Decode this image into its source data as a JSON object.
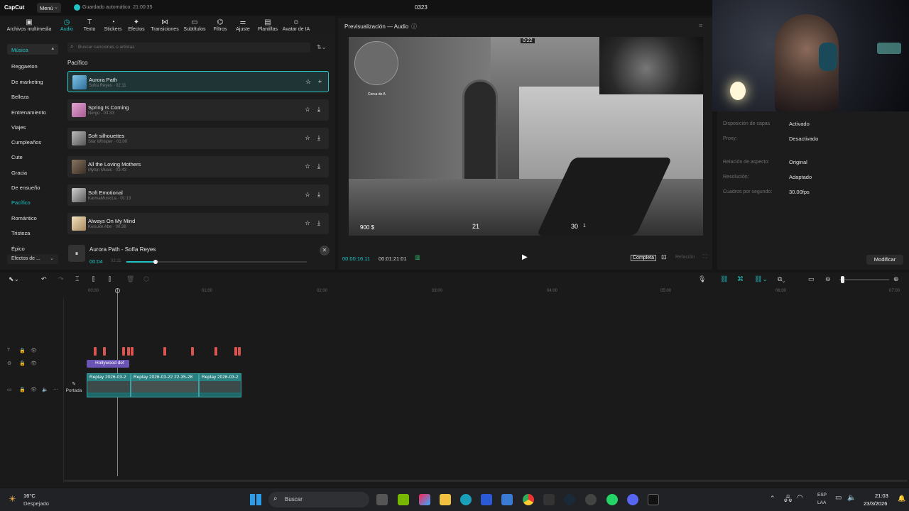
{
  "titlebar": {
    "app_name": "CapCut",
    "menu_label": "Menú",
    "autosave": "Guardado automático: 21:00:35",
    "project_name": "0323"
  },
  "toolbar": {
    "items": [
      {
        "label": "Archivos multimedia",
        "icon": "media-icon"
      },
      {
        "label": "Audio",
        "icon": "audio-icon"
      },
      {
        "label": "Texto",
        "icon": "text-icon"
      },
      {
        "label": "Stickers",
        "icon": "sticker-icon"
      },
      {
        "label": "Efectos",
        "icon": "effects-icon"
      },
      {
        "label": "Transiciones",
        "icon": "transitions-icon"
      },
      {
        "label": "Subtítulos",
        "icon": "subtitles-icon"
      },
      {
        "label": "Filtros",
        "icon": "filters-icon"
      },
      {
        "label": "Ajuste",
        "icon": "adjust-icon"
      },
      {
        "label": "Plantillas",
        "icon": "templates-icon"
      },
      {
        "label": "Avatar de IA",
        "icon": "ai-avatar-icon"
      }
    ]
  },
  "sidebar": {
    "header": "Música",
    "categories": [
      "Reggaeton",
      "De marketing",
      "Belleza",
      "Entrenamiento",
      "Viajes",
      "Cumpleaños",
      "Cute",
      "Gracia",
      "De ensueño",
      "Pacífico",
      "Romántico",
      "Tristeza",
      "Épico"
    ],
    "footer": "Efectos de ..."
  },
  "search": {
    "placeholder": "Buscar canciones o artistas"
  },
  "section_title": "Pacífico",
  "tracks": [
    {
      "name": "Aurora Path",
      "meta": "Sofía Reyes · 02:11",
      "color": "#4b8fb8"
    },
    {
      "name": "Spring Is Coming",
      "meta": "Nergo · 03:33",
      "color": "#c77fb5"
    },
    {
      "name": "Soft silhouettes",
      "meta": "Star Whisper · 01:00",
      "color": "#8a8a8a"
    },
    {
      "name": "All the Loving Mothers",
      "meta": "Myton Music · 03:43",
      "color": "#6b5a4a"
    },
    {
      "name": "Soft Emotional",
      "meta": "KarmaMusicLa · 01:13",
      "color": "#9a9a9a"
    },
    {
      "name": "Always On My Mind",
      "meta": "Keisuke Abe · 00:38",
      "color": "#d9c7a0"
    }
  ],
  "player": {
    "title": "Aurora Path - Sofía Reyes",
    "current": "00:04",
    "total": "02:11",
    "progress": 0.16
  },
  "preview": {
    "header": "Previsualización — Audio",
    "time_current": "00:00:16:11",
    "time_total": "00:01:21:01",
    "full_btn": "Completa",
    "ratio_btn": "Relación",
    "hud": {
      "money": "900 $",
      "health": "21",
      "ammo": "30",
      "reserve": "1",
      "timer": "0:22",
      "minimap_label": "Cerca de A"
    }
  },
  "properties": {
    "rows": [
      {
        "label": "Disposición de capas",
        "value": "Activado"
      },
      {
        "label": "Proxy:",
        "value": "Desactivado"
      },
      {
        "label": "Relación de aspecto:",
        "value": "Original"
      },
      {
        "label": "Resolución:",
        "value": "Adaptado"
      },
      {
        "label": "Cuadros por segundo:",
        "value": "30.00fps"
      }
    ],
    "modify_button": "Modificar"
  },
  "timeline": {
    "ruler": [
      "00:00",
      "01:00",
      "02:00",
      "03:00",
      "04:00",
      "05:00",
      "06:00",
      "07:00"
    ],
    "effect_clip": "Hollywood def",
    "cover_label": "Portada",
    "clips": [
      "Replay 2026-03-2",
      "Replay 2026-03-22 22-35-28",
      "Replay 2026-03-2"
    ]
  },
  "taskbar": {
    "weather_temp": "16°C",
    "weather_desc": "Despejado",
    "search_placeholder": "Buscar",
    "lang_top": "ESP",
    "lang_bottom": "LAA",
    "time": "21:03",
    "date": "23/3/2026"
  },
  "accent": "#20c4c4"
}
